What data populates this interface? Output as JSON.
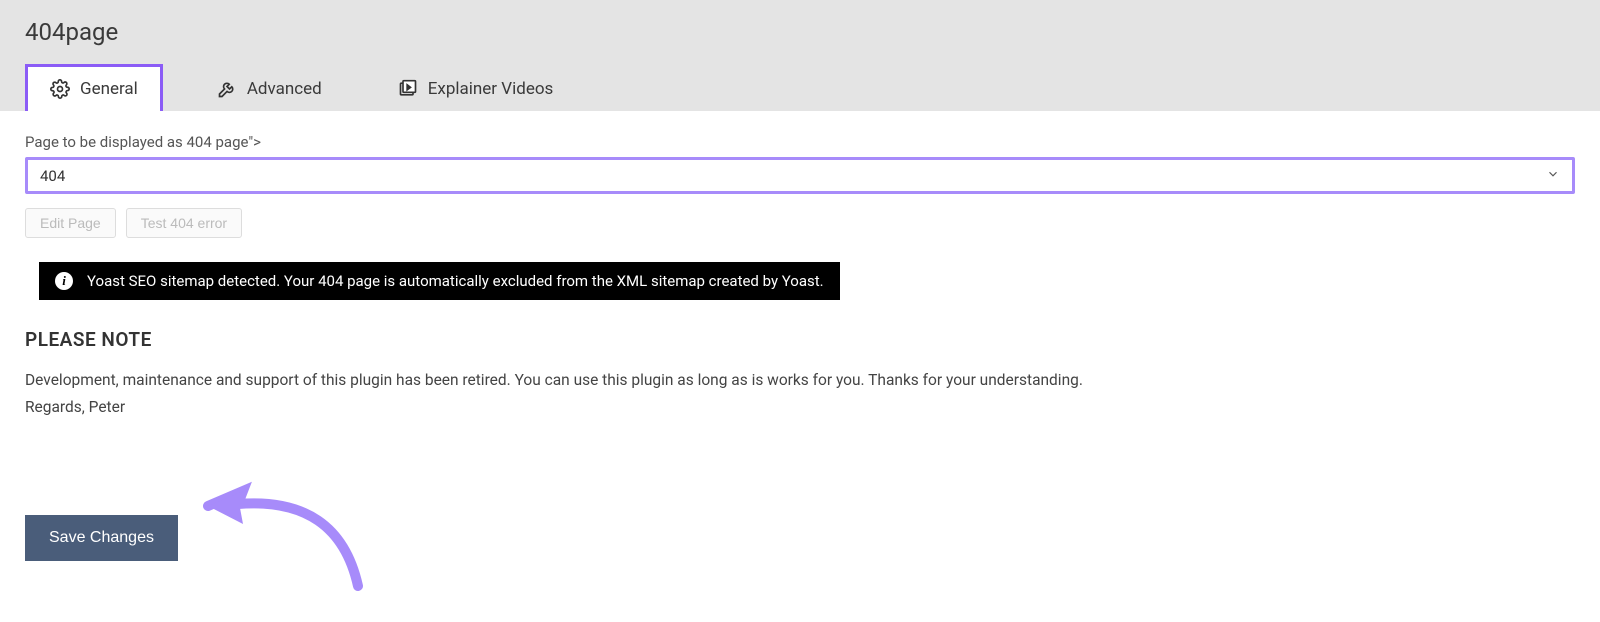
{
  "header": {
    "title": "404page"
  },
  "tabs": [
    {
      "label": "General",
      "icon": "gear-icon",
      "active": true
    },
    {
      "label": "Advanced",
      "icon": "wrench-icon",
      "active": false
    },
    {
      "label": "Explainer Videos",
      "icon": "video-icon",
      "active": false
    }
  ],
  "form": {
    "page_select_label": "Page to be displayed as 404 page\">",
    "page_select_value": "404",
    "edit_page_label": "Edit Page",
    "test_404_label": "Test 404 error"
  },
  "notice": {
    "text": "Yoast SEO sitemap detected. Your 404 page is automatically excluded from the XML sitemap created by Yoast."
  },
  "note": {
    "heading": "PLEASE NOTE",
    "line1": "Development, maintenance and support of this plugin has been retired. You can use this plugin as long as is works for you. Thanks for your understanding.",
    "line2": "Regards, Peter"
  },
  "actions": {
    "save_label": "Save Changes"
  },
  "colors": {
    "highlight": "#a78bfa",
    "primary_btn": "#4a5d7a"
  }
}
